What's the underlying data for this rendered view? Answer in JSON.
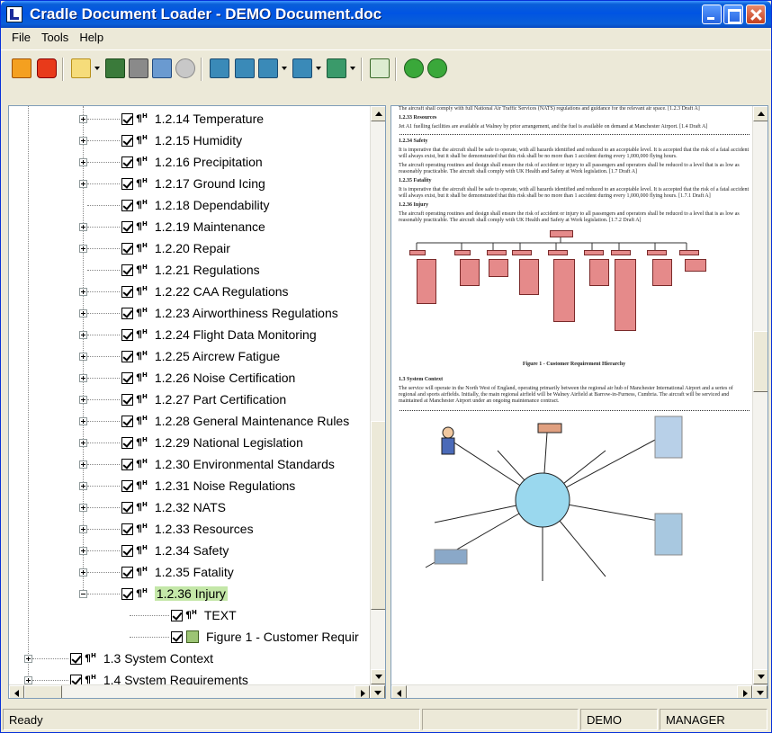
{
  "window": {
    "title": "Cradle Document Loader - DEMO Document.doc"
  },
  "menu": [
    "File",
    "Tools",
    "Help"
  ],
  "tree": {
    "items": [
      {
        "label": "1.2.14 Temperature",
        "exp": "plus"
      },
      {
        "label": "1.2.15 Humidity",
        "exp": "plus"
      },
      {
        "label": "1.2.16 Precipitation",
        "exp": "plus"
      },
      {
        "label": "1.2.17 Ground Icing",
        "exp": "plus"
      },
      {
        "label": "1.2.18 Dependability",
        "exp": "none"
      },
      {
        "label": "1.2.19 Maintenance",
        "exp": "plus"
      },
      {
        "label": "1.2.20 Repair",
        "exp": "plus"
      },
      {
        "label": "1.2.21 Regulations",
        "exp": "none"
      },
      {
        "label": "1.2.22 CAA Regulations",
        "exp": "plus"
      },
      {
        "label": "1.2.23 Airworthiness Regulations",
        "exp": "plus"
      },
      {
        "label": "1.2.24 Flight Data Monitoring",
        "exp": "plus"
      },
      {
        "label": "1.2.25 Aircrew Fatigue",
        "exp": "plus"
      },
      {
        "label": "1.2.26 Noise Certification",
        "exp": "plus"
      },
      {
        "label": "1.2.27 Part Certification",
        "exp": "plus"
      },
      {
        "label": "1.2.28 General Maintenance Rules",
        "exp": "plus"
      },
      {
        "label": "1.2.29 National Legislation",
        "exp": "plus"
      },
      {
        "label": "1.2.30 Environmental Standards",
        "exp": "plus"
      },
      {
        "label": "1.2.31 Noise Regulations",
        "exp": "plus"
      },
      {
        "label": "1.2.32 NATS",
        "exp": "plus"
      },
      {
        "label": "1.2.33 Resources",
        "exp": "plus"
      },
      {
        "label": "1.2.34 Safety",
        "exp": "plus"
      },
      {
        "label": "1.2.35 Fatality",
        "exp": "plus"
      },
      {
        "label": "1.2.36 Injury",
        "exp": "minus"
      }
    ],
    "children": [
      {
        "label": "TEXT"
      },
      {
        "label": "Figure 1 - Customer Requir"
      }
    ],
    "top_level": [
      {
        "label": "1.3 System Context"
      },
      {
        "label": "1.4 System Requirements"
      }
    ]
  },
  "doc": {
    "p1": "The aircraft shall comply with full National Air Traffic Services (NATS) regulations and guidance for the relevant air space. [1.2.3 Draft A]",
    "h_resources": "1.2.33 Resources",
    "p_resources": "Jet A1 fuelling facilities are available at Walney by prior arrangement, and the fuel is available on demand at Manchester Airport. [1.4 Draft A]",
    "h_safety": "1.2.34 Safety",
    "p_safety1": "It is imperative that the aircraft shall be safe to operate, with all hazards identified and reduced to an acceptable level. It is accepted that the risk of a fatal accident will always exist, but it shall be demonstrated that this risk shall be no more than 1 accident during every 1,000,000 flying hours.",
    "p_safety2": "The aircraft operating routines and design shall ensure the risk of accident or injury to all passengers and operators shall be reduced to a level that is as low as reasonably practicable. The aircraft shall comply with UK Health and Safety at Work legislation. [1.7 Draft A]",
    "h_fatality": "1.2.35 Fatality",
    "p_fatality": "It is imperative that the aircraft shall be safe to operate, with all hazards identified and reduced to an acceptable level. It is accepted that the risk of a fatal accident will always exist, but it shall be demonstrated that this risk shall be no more than 1 accident during every 1,000,000 flying hours. [1.7.1 Draft A]",
    "h_injury": "1.2.36 Injury",
    "p_injury": "The aircraft operating routines and design shall ensure the risk of accident or injury to all passengers and operators shall be reduced to a level that is as low as reasonably practicable. The aircraft shall comply with UK Health and Safety at Work legislation. [1.7.2 Draft A]",
    "caption": "Figure 1 - Customer Requirement Hierarchy",
    "h_context": "1.3 System Context",
    "p_context": "The service will operate in the North West of England, operating primarily between the regional air hub of Manchester International Airport and a series of regional and sports airfields. Initially, the main regional airfield will be Walney Airfield at Barrow-in-Furness, Cumbria. The aircraft will be serviced and maintained at Manchester Airport under an ongoing maintenance contract."
  },
  "status": {
    "ready": "Ready",
    "project": "DEMO",
    "user": "MANAGER"
  }
}
